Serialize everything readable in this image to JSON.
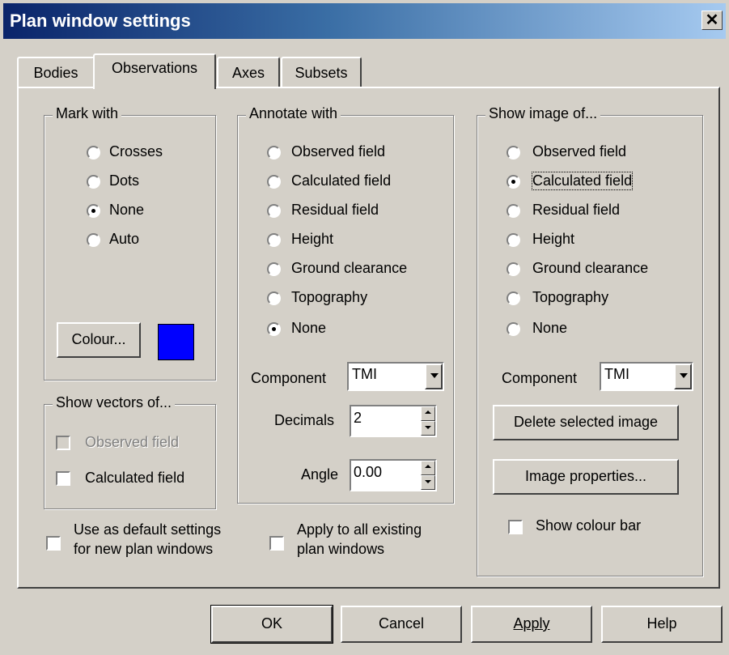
{
  "window": {
    "title": "Plan window settings",
    "close_glyph": "✕"
  },
  "tabs": [
    {
      "label": "Bodies",
      "active": false
    },
    {
      "label": "Observations",
      "active": true
    },
    {
      "label": "Axes",
      "active": false
    },
    {
      "label": "Subsets",
      "active": false
    }
  ],
  "mark_with": {
    "legend": "Mark with",
    "options": [
      {
        "label": "Crosses",
        "selected": false
      },
      {
        "label": "Dots",
        "selected": false
      },
      {
        "label": "None",
        "selected": true
      },
      {
        "label": "Auto",
        "selected": false
      }
    ],
    "colour_button": "Colour...",
    "colour_value": "#0000ff"
  },
  "show_vectors": {
    "legend": "Show vectors of...",
    "observed": {
      "label": "Observed field",
      "checked": false,
      "disabled": true
    },
    "calculated": {
      "label": "Calculated field",
      "checked": false,
      "disabled": false
    }
  },
  "annotate_with": {
    "legend": "Annotate with",
    "options": [
      {
        "label": "Observed field",
        "selected": false
      },
      {
        "label": "Calculated field",
        "selected": false
      },
      {
        "label": "Residual field",
        "selected": false
      },
      {
        "label": "Height",
        "selected": false
      },
      {
        "label": "Ground clearance",
        "selected": false
      },
      {
        "label": "Topography",
        "selected": false
      },
      {
        "label": "None",
        "selected": true
      }
    ],
    "component_label": "Component",
    "component_value": "TMI",
    "decimals_label": "Decimals",
    "decimals_value": "2",
    "angle_label": "Angle",
    "angle_value": "0.00"
  },
  "show_image": {
    "legend": "Show image of...",
    "options": [
      {
        "label": "Observed field",
        "selected": false
      },
      {
        "label": "Calculated field",
        "selected": true
      },
      {
        "label": "Residual field",
        "selected": false
      },
      {
        "label": "Height",
        "selected": false
      },
      {
        "label": "Ground clearance",
        "selected": false
      },
      {
        "label": "Topography",
        "selected": false
      },
      {
        "label": "None",
        "selected": false
      }
    ],
    "component_label": "Component",
    "component_value": "TMI",
    "delete_button": "Delete selected image",
    "properties_button": "Image properties...",
    "colour_bar": {
      "label": "Show colour bar",
      "checked": false
    }
  },
  "defaults": {
    "line1": "Use as default settings",
    "line2": "for new plan windows",
    "checked": false
  },
  "apply_all": {
    "line1": "Apply to all existing",
    "line2": "plan windows",
    "checked": false
  },
  "footer": {
    "ok": "OK",
    "cancel": "Cancel",
    "apply": "Apply",
    "help": "Help"
  }
}
